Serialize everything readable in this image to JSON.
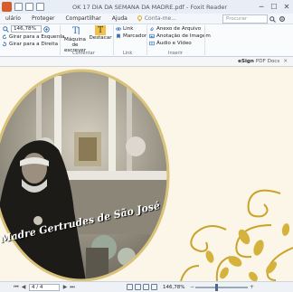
{
  "window": {
    "title": "OK 17 DIA DA SEMANA DA MADRE.pdf - Foxit Reader",
    "minimize": "─",
    "maximize": "☐",
    "close": "✕"
  },
  "menu": {
    "items": [
      "ulário",
      "Proteger",
      "Compartilhar",
      "Ajuda"
    ],
    "tell_me": "Conta-me...",
    "search_placeholder": "Procurar"
  },
  "ribbon": {
    "zoom_value": "146,78%",
    "rotate_left": "Girar para a Esquerda",
    "rotate_right": "Girar para a Direita",
    "typewriter_line1": "Máquina de",
    "typewriter_line2": "escrever",
    "highlight": "Destacar",
    "comment_group": "Comentar",
    "link": "Link",
    "bookmark": "Marcador",
    "links_group": "Link",
    "file_attachment": "Anexo de Arquivo",
    "image_annotation": "Anotação de Imagem",
    "audio_video": "Áudio e Vídeo",
    "insert_group": "Inserir"
  },
  "esign": {
    "brand": "eSign",
    "label": "PDF Docs"
  },
  "document": {
    "photo_caption": "Madre Gertrudes de São José"
  },
  "status": {
    "page_indicator": "4 / 4",
    "zoom_percent": "146,78%",
    "zoom_level": 0.38
  },
  "colors": {
    "accent": "#2f6db5",
    "page_bg": "#fbf6e8",
    "gold": "#c9a32a",
    "frame_gold": "#d9c27a",
    "caption_text": "#ffffff"
  }
}
